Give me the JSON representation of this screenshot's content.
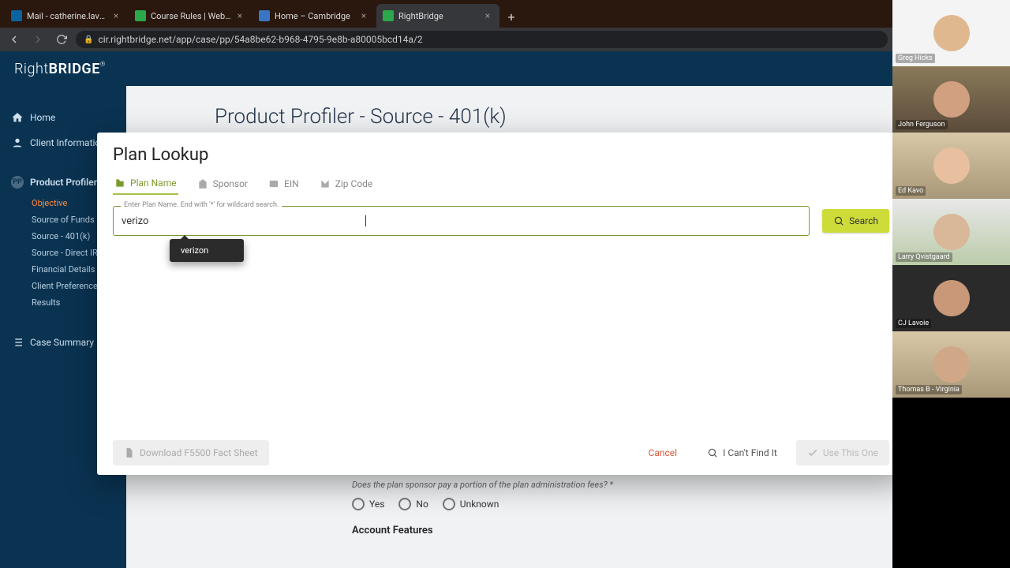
{
  "browser": {
    "tabs": [
      {
        "title": "Mail - catherine.lavoie@cambrid",
        "favicon": "#0a64a0"
      },
      {
        "title": "Course Rules | WebCE",
        "favicon": "#2aa84a"
      },
      {
        "title": "Home – Cambridge",
        "favicon": "#3a74c4"
      },
      {
        "title": "RightBridge",
        "favicon": "#2aa84a",
        "active": true
      }
    ],
    "url": "cir.rightbridge.net/app/case/pp/54a8be62-b968-4795-9e8b-a80005bcd14a/2"
  },
  "app": {
    "logo_a": "Right",
    "logo_b": "BRIDGE",
    "sidebar": {
      "home": "Home",
      "client_info": "Client Information",
      "product_profiler": "Product Profiler",
      "subs": {
        "objective": "Objective",
        "source_funds": "Source of Funds",
        "source_401k": "Source - 401(k)",
        "source_ira": "Source - Direct IR",
        "financial": "Financial Details",
        "client_pref": "Client Preference",
        "results": "Results"
      },
      "case_summary": "Case Summary"
    },
    "page_title": "Product Profiler - Source - 401(k)",
    "bg": {
      "question": "Does the plan sponsor pay a portion of the plan administration fees? *",
      "yes": "Yes",
      "no": "No",
      "unknown": "Unknown",
      "account_features": "Account Features"
    }
  },
  "modal": {
    "title": "Plan Lookup",
    "tabs": {
      "plan_name": "Plan Name",
      "sponsor": "Sponsor",
      "ein": "EIN",
      "zip": "Zip Code"
    },
    "input_label": "Enter Plan Name. End with '*' for wildcard search.",
    "input_value": "verizo",
    "autocomplete": "verizon",
    "search": "Search",
    "download": "Download F5500 Fact Sheet",
    "cancel": "Cancel",
    "cant_find": "I Can't Find It",
    "use": "Use This One"
  },
  "call": {
    "participants": [
      {
        "name": "Greg Hicks"
      },
      {
        "name": "John Ferguson"
      },
      {
        "name": "Ed Kavo"
      },
      {
        "name": "Larry Qvistgaard"
      },
      {
        "name": "CJ Lavoie"
      },
      {
        "name": "Thomas B - Virginia"
      }
    ]
  }
}
